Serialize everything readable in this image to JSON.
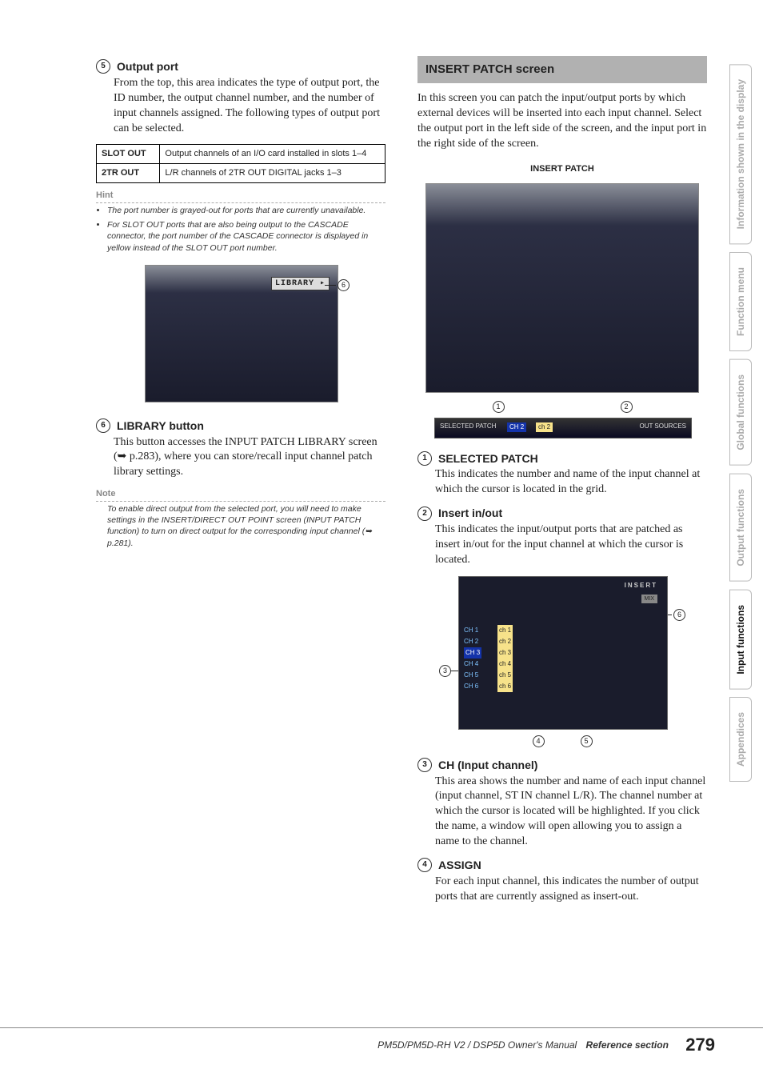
{
  "left": {
    "output_port": {
      "num": "5",
      "title": "Output port",
      "body": "From the top, this area indicates the type of output port, the ID number, the output channel number, and the number of input channels assigned. The following types of output port can be selected.",
      "table": {
        "r1k": "SLOT OUT",
        "r1v": "Output channels of an I/O card installed in slots 1–4",
        "r2k": "2TR OUT",
        "r2v": "L/R channels of 2TR OUT DIGITAL jacks 1–3"
      },
      "hint_label": "Hint",
      "hints": [
        "The port number is grayed-out for ports that are currently unavailable.",
        "For SLOT OUT ports that are also being output to the CASCADE connector, the port number of the CASCADE connector is displayed in yellow instead of the SLOT OUT port number."
      ],
      "lib_btn": "LIBRARY",
      "callout6": "6"
    },
    "library": {
      "num": "6",
      "title": "LIBRARY button",
      "body": "This button accesses the INPUT PATCH LIBRARY screen (➥ p.283), where you can store/recall input channel patch library settings.",
      "note_label": "Note",
      "note": "To enable direct output from the selected port, you will need to make settings in the INSERT/DIRECT OUT POINT screen (INPUT PATCH function) to turn on direct output for the corresponding input channel (➥ p.281)."
    }
  },
  "right": {
    "banner": "INSERT PATCH screen",
    "intro": "In this screen you can patch the input/output ports by which external devices will be inserted into each input channel. Select the output port in the left side of the screen, and the input port in the right side of the screen.",
    "small_heading": "INSERT PATCH",
    "bar": {
      "selected_patch_lbl": "SELECTED PATCH",
      "ch": "CH 2",
      "chbox": "ch 2",
      "out": "OUT SOURCES"
    },
    "c1": "1",
    "c2": "2",
    "sel_patch": {
      "num": "1",
      "title": "SELECTED PATCH",
      "body": "This indicates the number and name of the input channel at which the cursor is located in the grid."
    },
    "insert_io": {
      "num": "2",
      "title": "Insert in/out",
      "body": "This indicates the input/output ports that are patched as insert in/out for the input channel at which the cursor is located."
    },
    "grid": {
      "insert": "INSERT",
      "mix": "MIX",
      "ch_rows": [
        "CH 1",
        "CH 2",
        "CH 3",
        "CH 4",
        "CH 5",
        "CH 6"
      ],
      "assign_rows": [
        "ch 1",
        "ch 2",
        "ch 3",
        "ch 4",
        "ch 5",
        "ch 6"
      ]
    },
    "c3": "3",
    "c4": "4",
    "c5": "5",
    "c6": "6",
    "ch_input": {
      "num": "3",
      "title": "CH (Input channel)",
      "body": "This area shows the number and name of each input channel (input channel, ST IN channel L/R). The channel number at which the cursor is located will be highlighted. If you click the name, a window will open allowing you to assign a name to the channel."
    },
    "assign": {
      "num": "4",
      "title": "ASSIGN",
      "body": "For each input channel, this indicates the number of output ports that are currently assigned as insert-out."
    }
  },
  "tabs": {
    "t1": "Information shown in the display",
    "t2": "Function menu",
    "t3": "Global functions",
    "t4": "Output functions",
    "t5": "Input functions",
    "t6": "Appendices"
  },
  "footer": {
    "model": "PM5D/PM5D-RH V2 / DSP5D Owner's Manual",
    "section": "Reference section",
    "page": "279"
  }
}
